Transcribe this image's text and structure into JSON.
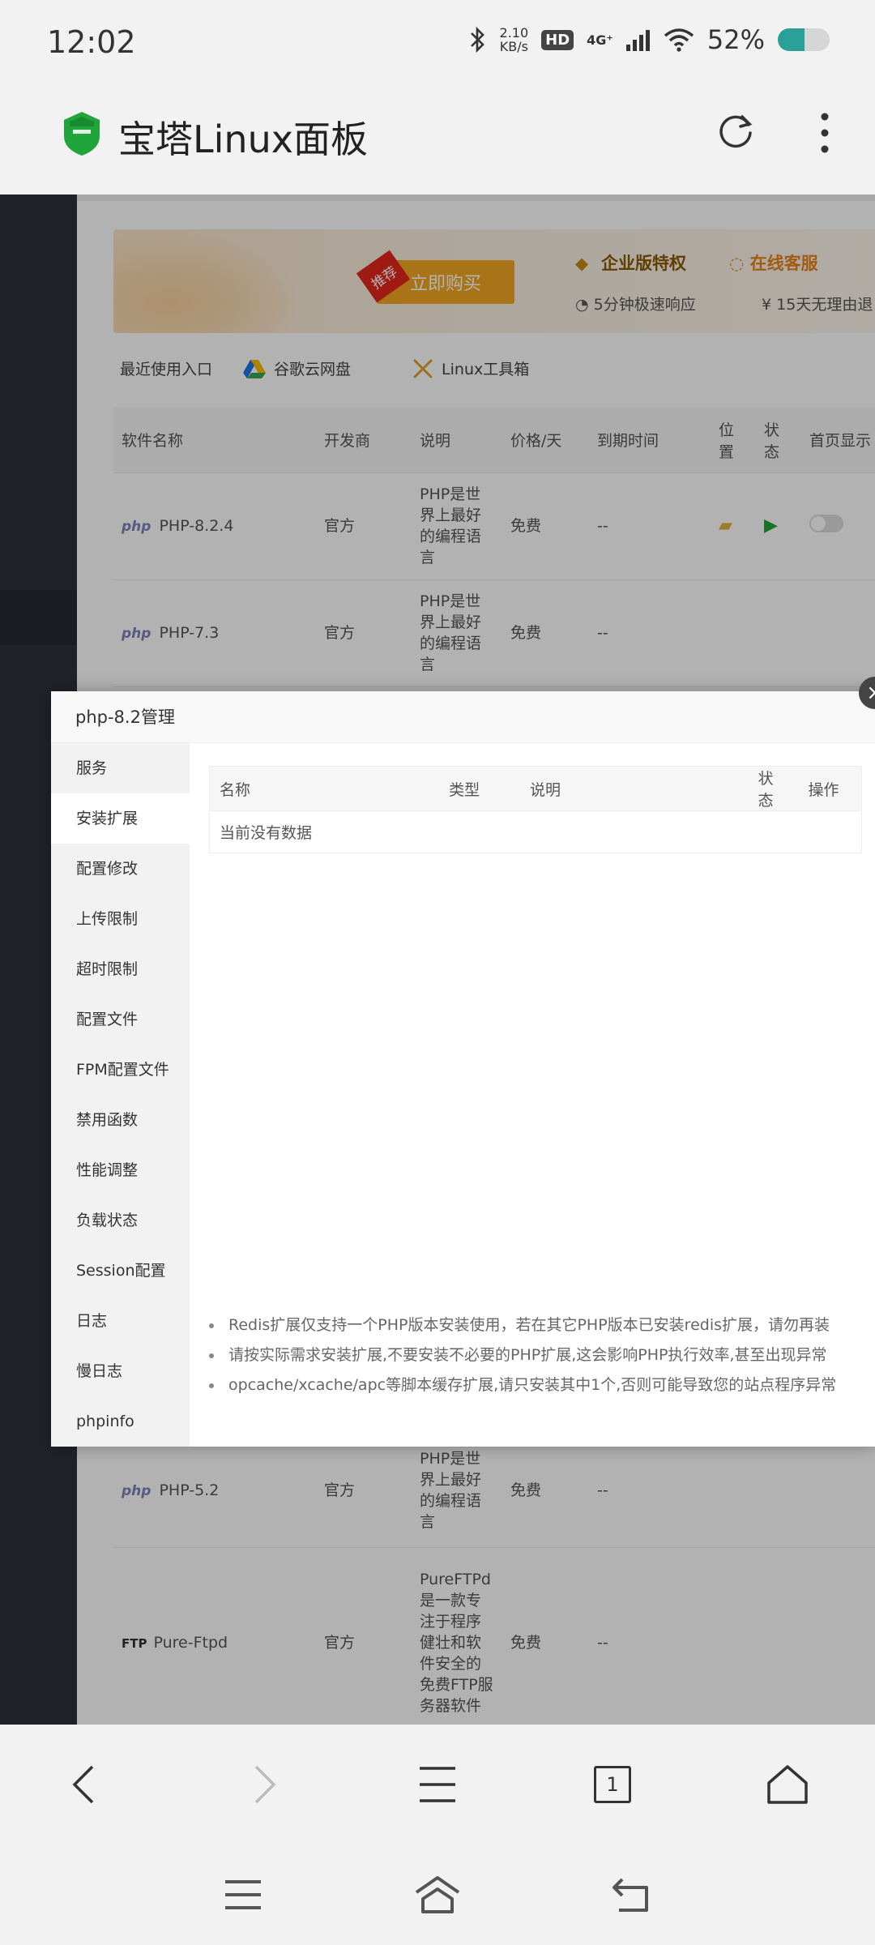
{
  "status_bar": {
    "time": "12:02",
    "speed_value": "2.10",
    "speed_unit": "KB/s",
    "hd": "HD",
    "network": "4G⁺",
    "battery_percent": "52%",
    "battery_level": 0.52
  },
  "app_bar": {
    "title": "宝塔Linux面板",
    "logo": "bt-logo-icon",
    "refresh": "refresh-icon",
    "more": "more-vertical-icon"
  },
  "banner": {
    "recommend_tag": "推荐",
    "buy_label": "立即购买",
    "enterprise": "企业版特权",
    "online_service": "在线客服",
    "response": "5分钟极速响应",
    "refund": "15天无理由退"
  },
  "quick_links": {
    "recent": "最近使用入口",
    "gdrive": "谷歌云网盘",
    "linux_tools": "Linux工具箱"
  },
  "software_table": {
    "headers": {
      "name": "软件名称",
      "developer": "开发商",
      "desc": "说明",
      "price": "价格/天",
      "expire": "到期时间",
      "location": "位置",
      "status": "状态",
      "homepage": "首页显示"
    },
    "rows": [
      {
        "icon": "php",
        "name": "PHP-8.2.4",
        "developer": "官方",
        "desc": "PHP是世界上最好的编程语言",
        "price": "免费",
        "expire": "--"
      },
      {
        "icon": "php",
        "name": "PHP-7.3",
        "developer": "官方",
        "desc": "PHP是世界上最好的编程语言",
        "price": "免费",
        "expire": "--"
      },
      {
        "icon": "php",
        "name": "PHP-5.2",
        "developer": "官方",
        "desc": "PHP是世界上最好的编程语言",
        "price": "免费",
        "expire": "--"
      },
      {
        "icon": "FTP",
        "name": "Pure-Ftpd",
        "developer": "官方",
        "desc": "PureFTPd是一款专注于程序健壮和软件安全的免费FTP服务器软件",
        "price": "免费",
        "expire": "--"
      }
    ]
  },
  "modal": {
    "title": "php-8.2管理",
    "nav": [
      "服务",
      "安装扩展",
      "配置修改",
      "上传限制",
      "超时限制",
      "配置文件",
      "FPM配置文件",
      "禁用函数",
      "性能调整",
      "负载状态",
      "Session配置",
      "日志",
      "慢日志",
      "phpinfo"
    ],
    "active_index": 1,
    "ext_table": {
      "headers": {
        "name": "名称",
        "type": "类型",
        "desc": "说明",
        "status": "状态",
        "action": "操作"
      },
      "empty": "当前没有数据"
    },
    "tips": [
      "Redis扩展仅支持一个PHP版本安装使用，若在其它PHP版本已安装redis扩展，请勿再装",
      "请按实际需求安装扩展,不要安装不必要的PHP扩展,这会影响PHP执行效率,甚至出现异常",
      "opcache/xcache/apc等脚本缓存扩展,请只安装其中1个,否则可能导致您的站点程序异常"
    ]
  },
  "browser_bar": {
    "tab_count": "1"
  }
}
